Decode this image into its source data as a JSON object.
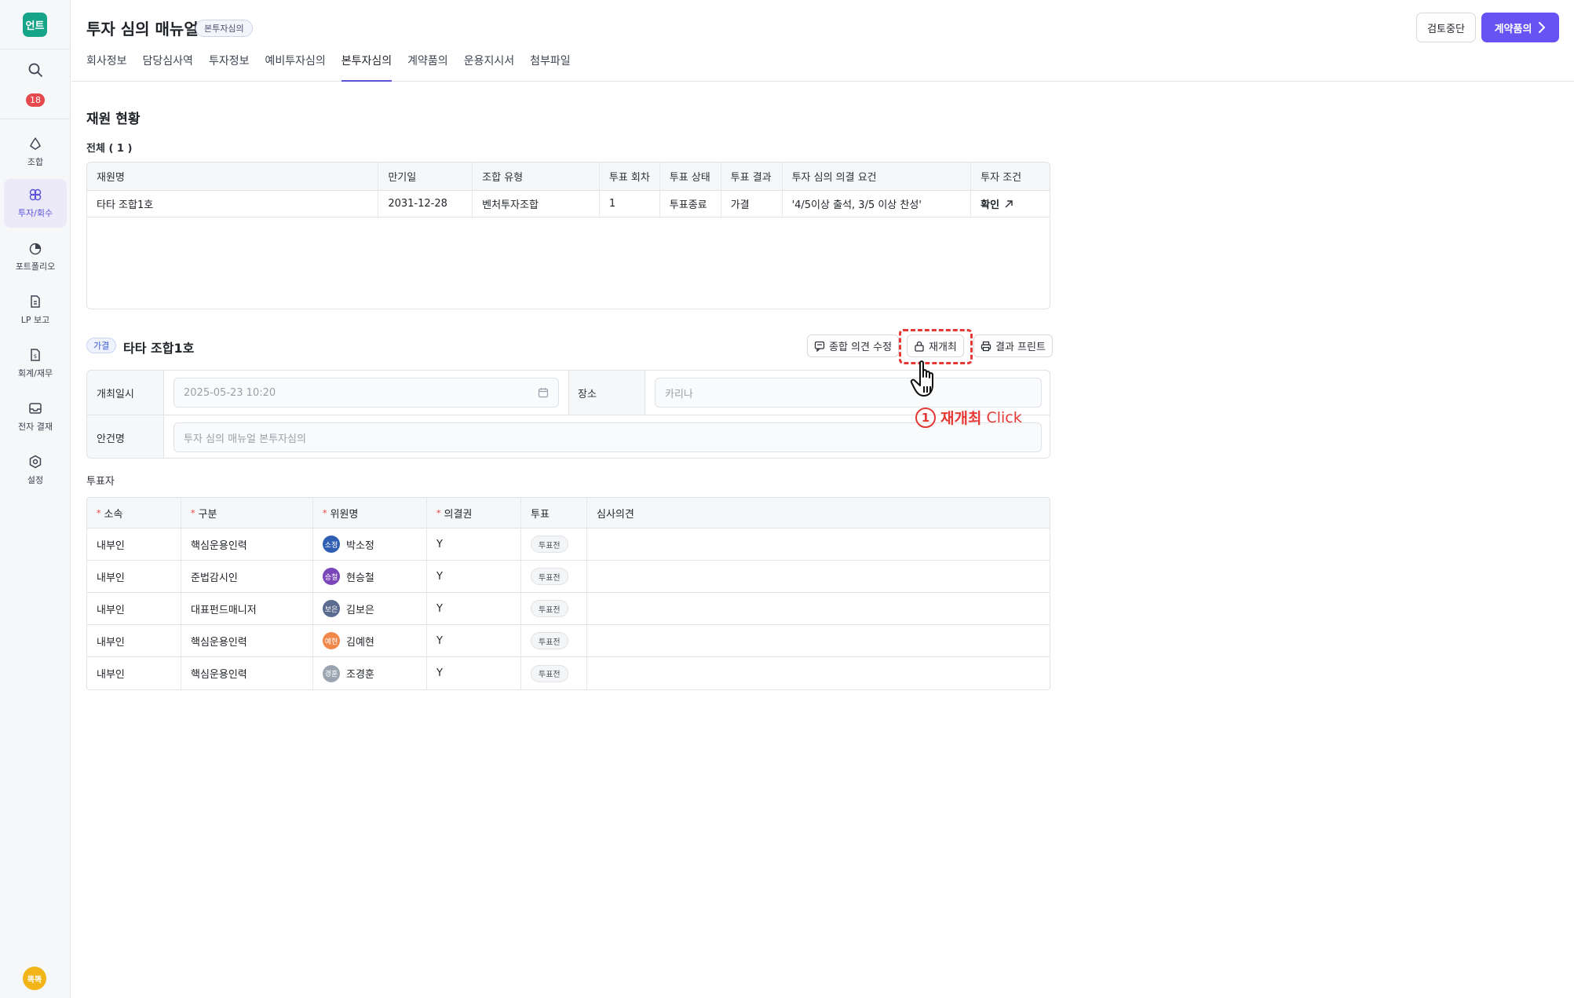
{
  "sidebar": {
    "logo_text": "언트",
    "notification_count": "18",
    "items": [
      {
        "label": "조합",
        "icon": "recycle-icon"
      },
      {
        "label": "투자/회수",
        "icon": "investment-icon"
      },
      {
        "label": "포트폴리오",
        "icon": "pie-chart-icon"
      },
      {
        "label": "LP 보고",
        "icon": "report-file-icon"
      },
      {
        "label": "회계/재무",
        "icon": "finance-file-icon"
      },
      {
        "label": "전자 결재",
        "icon": "inbox-icon"
      },
      {
        "label": "설정",
        "icon": "gear-icon"
      }
    ],
    "user_avatar_text": "똑똑"
  },
  "header": {
    "title": "투자 심의 매뉴얼",
    "badge": "본투자심의",
    "stop_button": "검토중단",
    "contract_button": "계약품의",
    "tabs": [
      "회사정보",
      "담당심사역",
      "투자정보",
      "예비투자심의",
      "본투자심의",
      "계약품의",
      "운용지시서",
      "첨부파일"
    ],
    "active_tab": "본투자심의"
  },
  "funds": {
    "section_title": "재원 현황",
    "count_label": "전체 ( 1 )",
    "columns": [
      "재원명",
      "만기일",
      "조합 유형",
      "투표 회차",
      "투표 상태",
      "투표 결과",
      "투자 심의 의결 요건",
      "투자 조건"
    ],
    "rows": [
      {
        "name": "타타 조합1호",
        "maturity": "2031-12-28",
        "type": "벤처투자조합",
        "round": "1",
        "status": "투표종료",
        "result": "가결",
        "requirement": "'4/5이상 출석, 3/5 이상 찬성'",
        "condition": "확인"
      }
    ]
  },
  "meeting": {
    "result_badge": "가결",
    "fund_name": "타타 조합1호",
    "buttons": {
      "edit_opinion": "종합 의견 수정",
      "reopen": "재개최",
      "print_result": "결과 프린트"
    },
    "date_label": "개최일시",
    "date_value": "2025-05-23 10:20",
    "place_label": "장소",
    "place_placeholder": "카리나",
    "agenda_label": "안건명",
    "agenda_placeholder": "투자 심의 매뉴얼 본투자심의"
  },
  "annotation": {
    "number": "1",
    "action": "재개최",
    "suffix": "Click",
    "color": "#e53935"
  },
  "voters": {
    "label": "투표자",
    "columns": [
      "소속",
      "구분",
      "위원명",
      "의결권",
      "투표",
      "심사의견"
    ],
    "required_columns": [
      true,
      true,
      true,
      true,
      false,
      false
    ],
    "rows": [
      {
        "affiliation": "내부인",
        "category": "핵심운용인력",
        "avatar": "소정",
        "avatar_color": "#2f5fb3",
        "name": "박소정",
        "voting_right": "Y",
        "vote": "투표전",
        "opinion": ""
      },
      {
        "affiliation": "내부인",
        "category": "준법감시인",
        "avatar": "승철",
        "avatar_color": "#7a45b8",
        "name": "현승철",
        "voting_right": "Y",
        "vote": "투표전",
        "opinion": ""
      },
      {
        "affiliation": "내부인",
        "category": "대표펀드매니저",
        "avatar": "보은",
        "avatar_color": "#5a6b8f",
        "name": "김보은",
        "voting_right": "Y",
        "vote": "투표전",
        "opinion": ""
      },
      {
        "affiliation": "내부인",
        "category": "핵심운용인력",
        "avatar": "예현",
        "avatar_color": "#f0884a",
        "name": "김예현",
        "voting_right": "Y",
        "vote": "투표전",
        "opinion": ""
      },
      {
        "affiliation": "내부인",
        "category": "핵심운용인력",
        "avatar": "경훈",
        "avatar_color": "#9aa5b1",
        "name": "조경훈",
        "voting_right": "Y",
        "vote": "투표전",
        "opinion": ""
      }
    ]
  },
  "colors": {
    "accent": "#6752f3",
    "logo": "#17a589",
    "highlight": "#e53935"
  }
}
